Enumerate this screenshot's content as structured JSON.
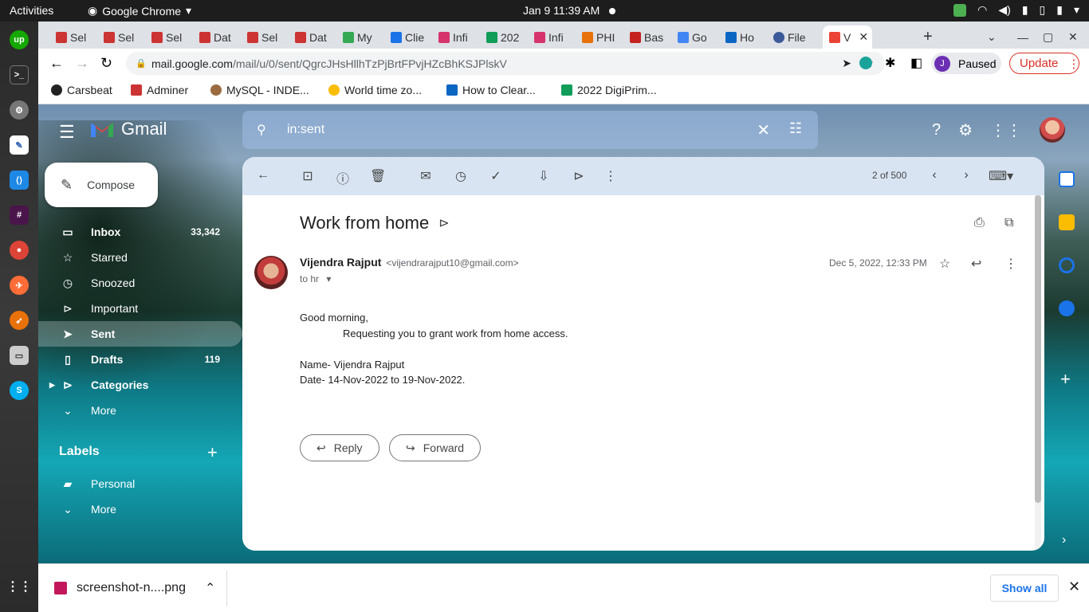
{
  "system": {
    "activities": "Activities",
    "app_name": "Google Chrome",
    "clock": "Jan 9  11:39 AM"
  },
  "tabs": [
    {
      "label": "Sel",
      "color": "#c33"
    },
    {
      "label": "Sel",
      "color": "#c33"
    },
    {
      "label": "Sel",
      "color": "#c33"
    },
    {
      "label": "Dat",
      "color": "#c33"
    },
    {
      "label": "Sel",
      "color": "#c33"
    },
    {
      "label": "Dat",
      "color": "#c33"
    },
    {
      "label": "My",
      "color": "#34a853"
    },
    {
      "label": "Clie",
      "color": "#1a73e8"
    },
    {
      "label": "Infi",
      "color": "#d6336c"
    },
    {
      "label": "202",
      "color": "#0f9d58"
    },
    {
      "label": "Infi",
      "color": "#d6336c"
    },
    {
      "label": "PHI",
      "color": "#e8710a"
    },
    {
      "label": "Bas",
      "color": "#c5221f"
    },
    {
      "label": "Go",
      "color": "#4285f4"
    },
    {
      "label": "Ho",
      "color": "#0a66c2"
    },
    {
      "label": "File",
      "color": "#3c5a99"
    },
    {
      "label": "V",
      "color": "#ea4335"
    }
  ],
  "omnibox": {
    "host": "mail.google.com",
    "path": "/mail/u/0/sent/QgrcJHsHllhTzPjBrtFPvjHZcBhKSJPlskV",
    "profile_status": "Paused",
    "profile_initial": "J",
    "update_label": "Update"
  },
  "bookmarks": [
    {
      "label": "Carsbeat"
    },
    {
      "label": "Adminer"
    },
    {
      "label": "MySQL - INDE..."
    },
    {
      "label": "World time zo..."
    },
    {
      "label": "How to Clear..."
    },
    {
      "label": "2022 DigiPrim..."
    }
  ],
  "gmail": {
    "brand": "Gmail",
    "search_query": "in:sent",
    "compose_label": "Compose",
    "nav": [
      {
        "label": "Inbox",
        "count": "33,342",
        "icon": "inbox-icon"
      },
      {
        "label": "Starred",
        "count": "",
        "icon": "star-icon"
      },
      {
        "label": "Snoozed",
        "count": "",
        "icon": "clock-icon"
      },
      {
        "label": "Important",
        "count": "",
        "icon": "important-icon"
      },
      {
        "label": "Sent",
        "count": "",
        "icon": "send-icon"
      },
      {
        "label": "Drafts",
        "count": "119",
        "icon": "draft-icon"
      },
      {
        "label": "Categories",
        "count": "",
        "icon": "label-icon"
      },
      {
        "label": "More",
        "count": "",
        "icon": "chevron-down-icon"
      }
    ],
    "labels_header": "Labels",
    "labels": [
      {
        "label": "Personal"
      },
      {
        "label": "More"
      }
    ],
    "pager": "2 of 500"
  },
  "email": {
    "subject": "Work from home",
    "sender_name": "Vijendra Rajput",
    "sender_email": "<vijendrarajput10@gmail.com>",
    "to": "to hr",
    "date": "Dec 5, 2022, 12:33 PM",
    "body_lines": [
      "Good morning,",
      "Requesting you to grant work from home access.",
      "",
      "Name- Vijendra Rajput",
      "Date- 14-Nov-2022 to 19-Nov-2022."
    ],
    "reply_label": "Reply",
    "forward_label": "Forward"
  },
  "downloads": {
    "file": "screenshot-n....png",
    "show_all": "Show all"
  }
}
